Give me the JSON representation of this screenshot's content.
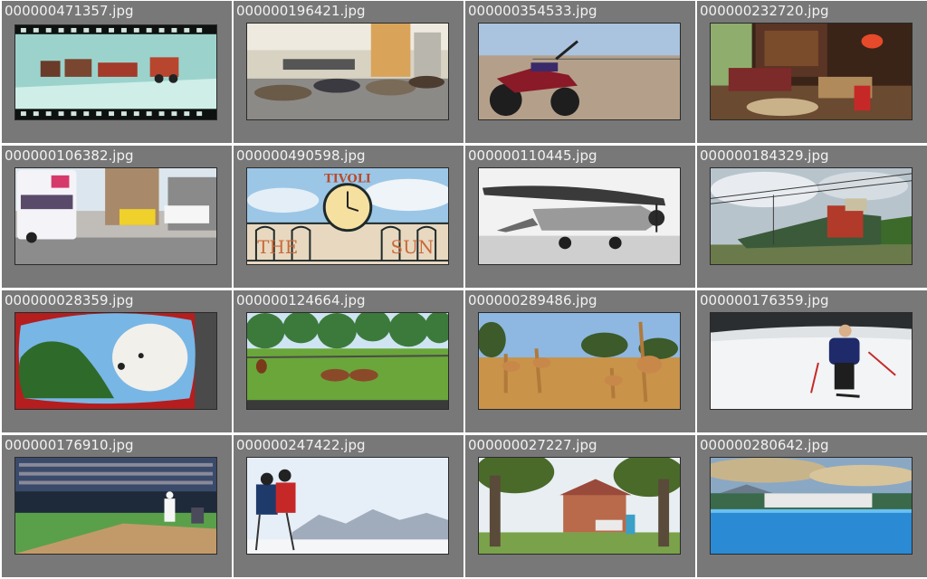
{
  "gallery": {
    "tiles": [
      {
        "filename": "000000471357.jpg",
        "subject": "toy-train-film-strip"
      },
      {
        "filename": "000000196421.jpg",
        "subject": "people-sleeping-airport"
      },
      {
        "filename": "000000354533.jpg",
        "subject": "motorcycle-desert"
      },
      {
        "filename": "000000232720.jpg",
        "subject": "living-room"
      },
      {
        "filename": "000000106382.jpg",
        "subject": "city-bus-street"
      },
      {
        "filename": "000000490598.jpg",
        "subject": "clock-sign"
      },
      {
        "filename": "000000110445.jpg",
        "subject": "vintage-airplane"
      },
      {
        "filename": "000000184329.jpg",
        "subject": "train-railway"
      },
      {
        "filename": "000000028359.jpg",
        "subject": "dog-in-car-mirror"
      },
      {
        "filename": "000000124664.jpg",
        "subject": "horses-pasture"
      },
      {
        "filename": "000000289486.jpg",
        "subject": "giraffes-savanna"
      },
      {
        "filename": "000000176359.jpg",
        "subject": "skier-slope"
      },
      {
        "filename": "000000176910.jpg",
        "subject": "baseball-game"
      },
      {
        "filename": "000000247422.jpg",
        "subject": "skiers-mountains"
      },
      {
        "filename": "000000027227.jpg",
        "subject": "person-on-bench-park"
      },
      {
        "filename": "000000280642.jpg",
        "subject": "resort-pool"
      }
    ],
    "sign_text": {
      "top": "TIVOLI",
      "bottom_left": "THE",
      "bottom_right": "SUN"
    }
  }
}
